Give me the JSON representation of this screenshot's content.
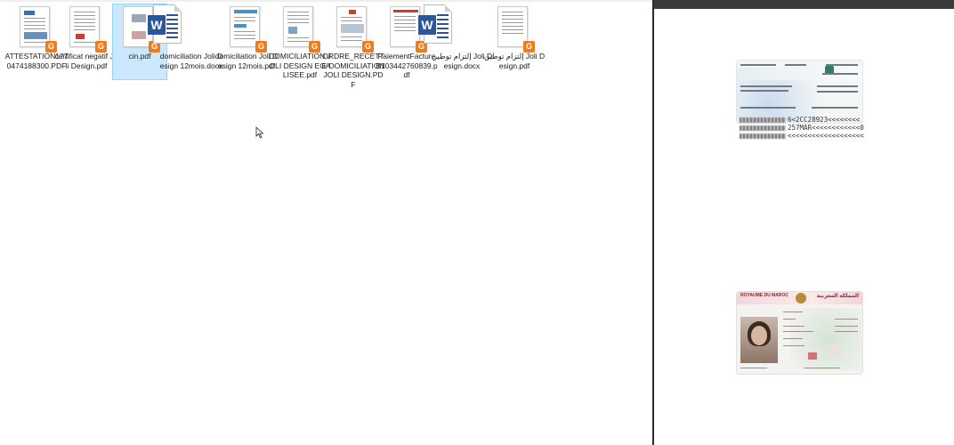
{
  "files": [
    {
      "name": "ATTESTATION1770474188300.PDF",
      "type": "pdf"
    },
    {
      "name": "certificat negatif Joli Design.pdf",
      "type": "pdf"
    },
    {
      "name": "cin.pdf",
      "type": "pdf",
      "selected": true
    },
    {
      "name": "domiciliation Joli Design 12mois.docx",
      "type": "docx"
    },
    {
      "name": "domiciliation Joli Design 12mois.pdf",
      "type": "pdf"
    },
    {
      "name": "DOMICILIATION JOLI DESIGN EGALISEE.pdf",
      "type": "pdf"
    },
    {
      "name": "ORDRE_RECETTE DOMICILIATION JOLI DESIGN.PDF",
      "type": "pdf"
    },
    {
      "name": "PaiementFacture B103442760839.pdf",
      "type": "pdf"
    },
    {
      "name": "إلتزام توطين Joli Design.docx",
      "type": "docx"
    },
    {
      "name": "إلتزام توطين Joli Design.pdf",
      "type": "pdf"
    }
  ],
  "preview": {
    "mrz": [
      {
        "visible": "6<2CC28923<<<<<<<<"
      },
      {
        "visible": "257MAR<<<<<<<<<<<<0"
      },
      {
        "visible": "<<<<<<<<<<<<<<<<<<<"
      }
    ],
    "front": {
      "header_left": "ROYAUME DU MAROC",
      "header_right": "المملكة المغربية"
    }
  },
  "colors": {
    "selection": "#cce8ff",
    "pdf_badge": "#f07b1d",
    "word_blue": "#2b579a",
    "divider": "#2b2b2b"
  }
}
